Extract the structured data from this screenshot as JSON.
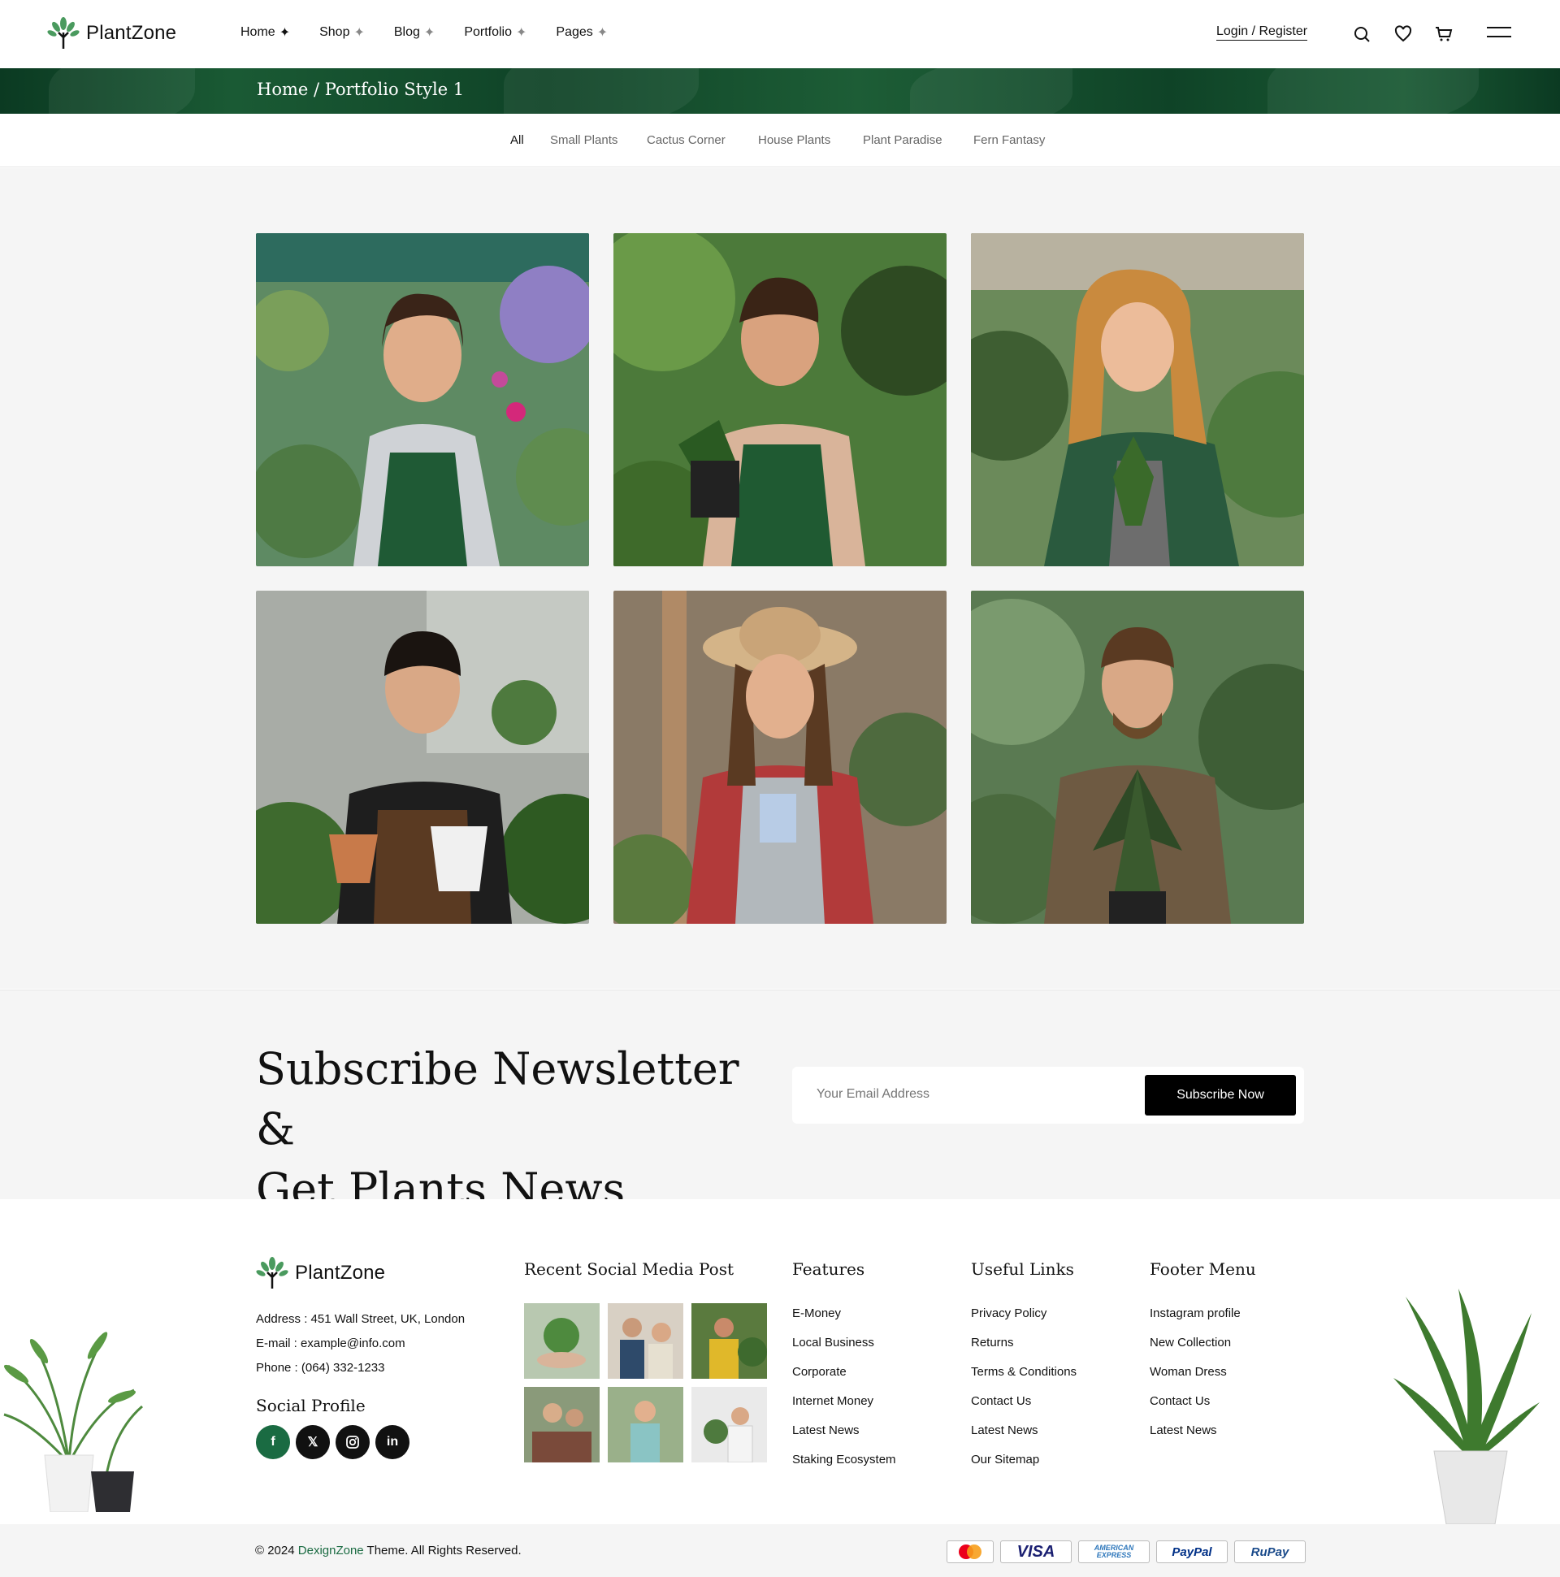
{
  "header": {
    "logo_text": "PlantZone",
    "nav": [
      {
        "label": "Home",
        "active": true
      },
      {
        "label": "Shop"
      },
      {
        "label": "Blog"
      },
      {
        "label": "Portfolio"
      },
      {
        "label": "Pages"
      }
    ],
    "login": "Login / Register",
    "icons": [
      "search-icon",
      "heart-icon",
      "cart-icon",
      "menu-icon"
    ]
  },
  "breadcrumb": {
    "text": "Home / Portfolio Style 1"
  },
  "filters": [
    "All",
    "Small Plants",
    "Cactus Corner",
    "House Plants",
    "Plant Paradise",
    "Fern Fantasy"
  ],
  "portfolio": {
    "items": [
      {
        "label": "woman-with-flowers"
      },
      {
        "label": "man-with-potted-plant"
      },
      {
        "label": "blonde-woman-with-plant"
      },
      {
        "label": "man-with-two-pots"
      },
      {
        "label": "woman-in-straw-hat"
      },
      {
        "label": "bearded-man-with-plant"
      }
    ]
  },
  "newsletter": {
    "title_line1": "Subscribe Newsletter &",
    "title_line2": "Get Plants News",
    "input_placeholder": "Your Email Address",
    "button": "Subscribe Now"
  },
  "footer": {
    "logo_text": "PlantZone",
    "address": "Address : 451 Wall Street, UK, London",
    "email": "E-mail : example@info.com",
    "phone": "Phone : (064) 332-1233",
    "social_title": "Social Profile",
    "social_icons": [
      "facebook-icon",
      "x-icon",
      "instagram-icon",
      "linkedin-icon"
    ],
    "recent_title": "Recent Social Media Post",
    "features_title": "Features",
    "features": [
      "E-Money",
      "Local Business",
      "Corporate",
      "Internet Money",
      "Latest News",
      "Staking Ecosystem"
    ],
    "useful_title": "Useful Links",
    "useful": [
      "Privacy Policy",
      "Returns",
      "Terms & Conditions",
      "Contact Us",
      "Latest News",
      "Our Sitemap"
    ],
    "menu_title": "Footer Menu",
    "menu": [
      "Instagram profile",
      "New Collection",
      "Woman Dress",
      "Contact Us",
      "Latest News"
    ]
  },
  "bottom": {
    "copy_prefix": "© 2024 ",
    "copy_brand": "DexignZone",
    "copy_suffix": " Theme. All Rights Reserved.",
    "payments": [
      "MasterCard",
      "VISA",
      "AMERICAN EXPRESS",
      "PayPal",
      "RuPay"
    ]
  },
  "colors": {
    "accent": "#1a6b42",
    "dark": "#111111",
    "banner": "#0f4327"
  }
}
